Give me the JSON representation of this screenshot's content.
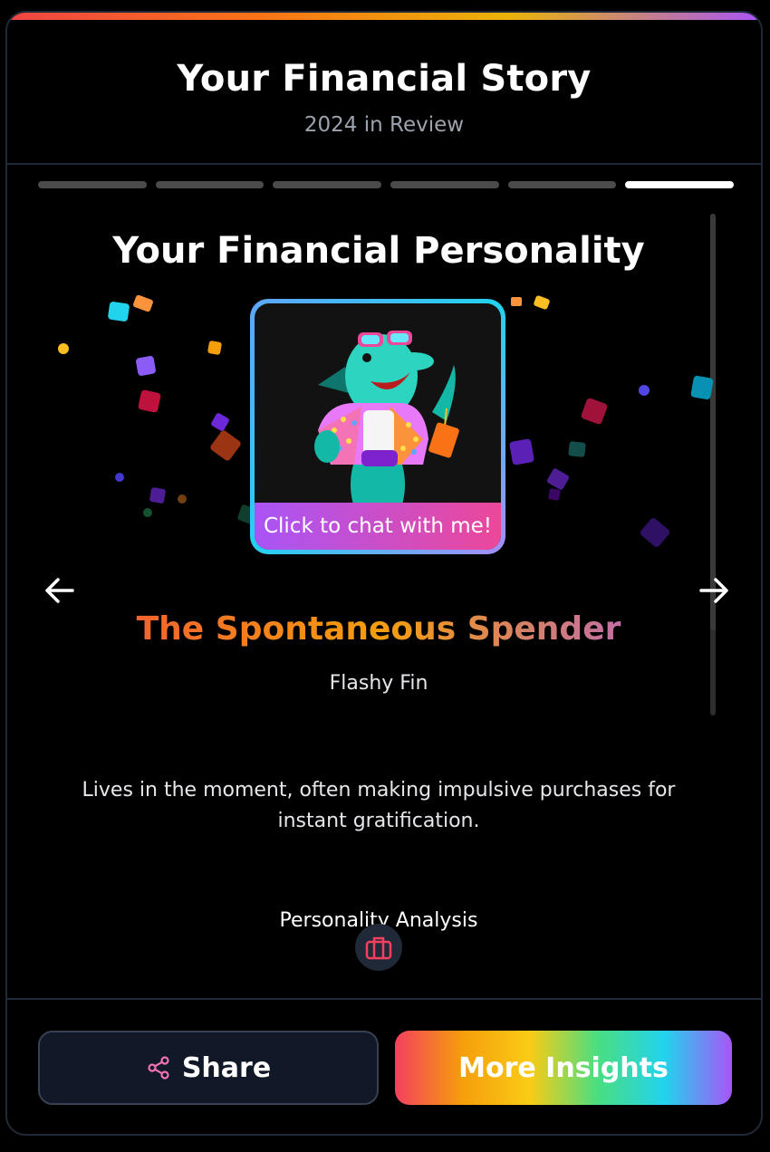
{
  "header": {
    "title": "Your Financial Story",
    "subtitle": "2024 in Review"
  },
  "progress": {
    "total_steps": 6,
    "current_step": 6
  },
  "slide": {
    "title": "Your Financial Personality",
    "avatar": {
      "icon": "dolphin-avatar-icon",
      "chat_label": "Click to chat with me!"
    },
    "persona_name": "The Spontaneous Spender",
    "persona_subtitle": "Flashy Fin",
    "description": "Lives in the moment, often making impulsive purchases for instant gratification.",
    "analysis_label": "Personality Analysis",
    "analysis_icon": "briefcase-icon",
    "prev_icon": "arrow-left-icon",
    "next_icon": "arrow-right-icon"
  },
  "footer": {
    "share_label": "Share",
    "share_icon": "share-icon",
    "insights_label": "More Insights"
  },
  "colors": {
    "background": "#000000",
    "accent_pink": "#ec4899",
    "accent_purple": "#a855f7",
    "border": "#1f2937"
  }
}
